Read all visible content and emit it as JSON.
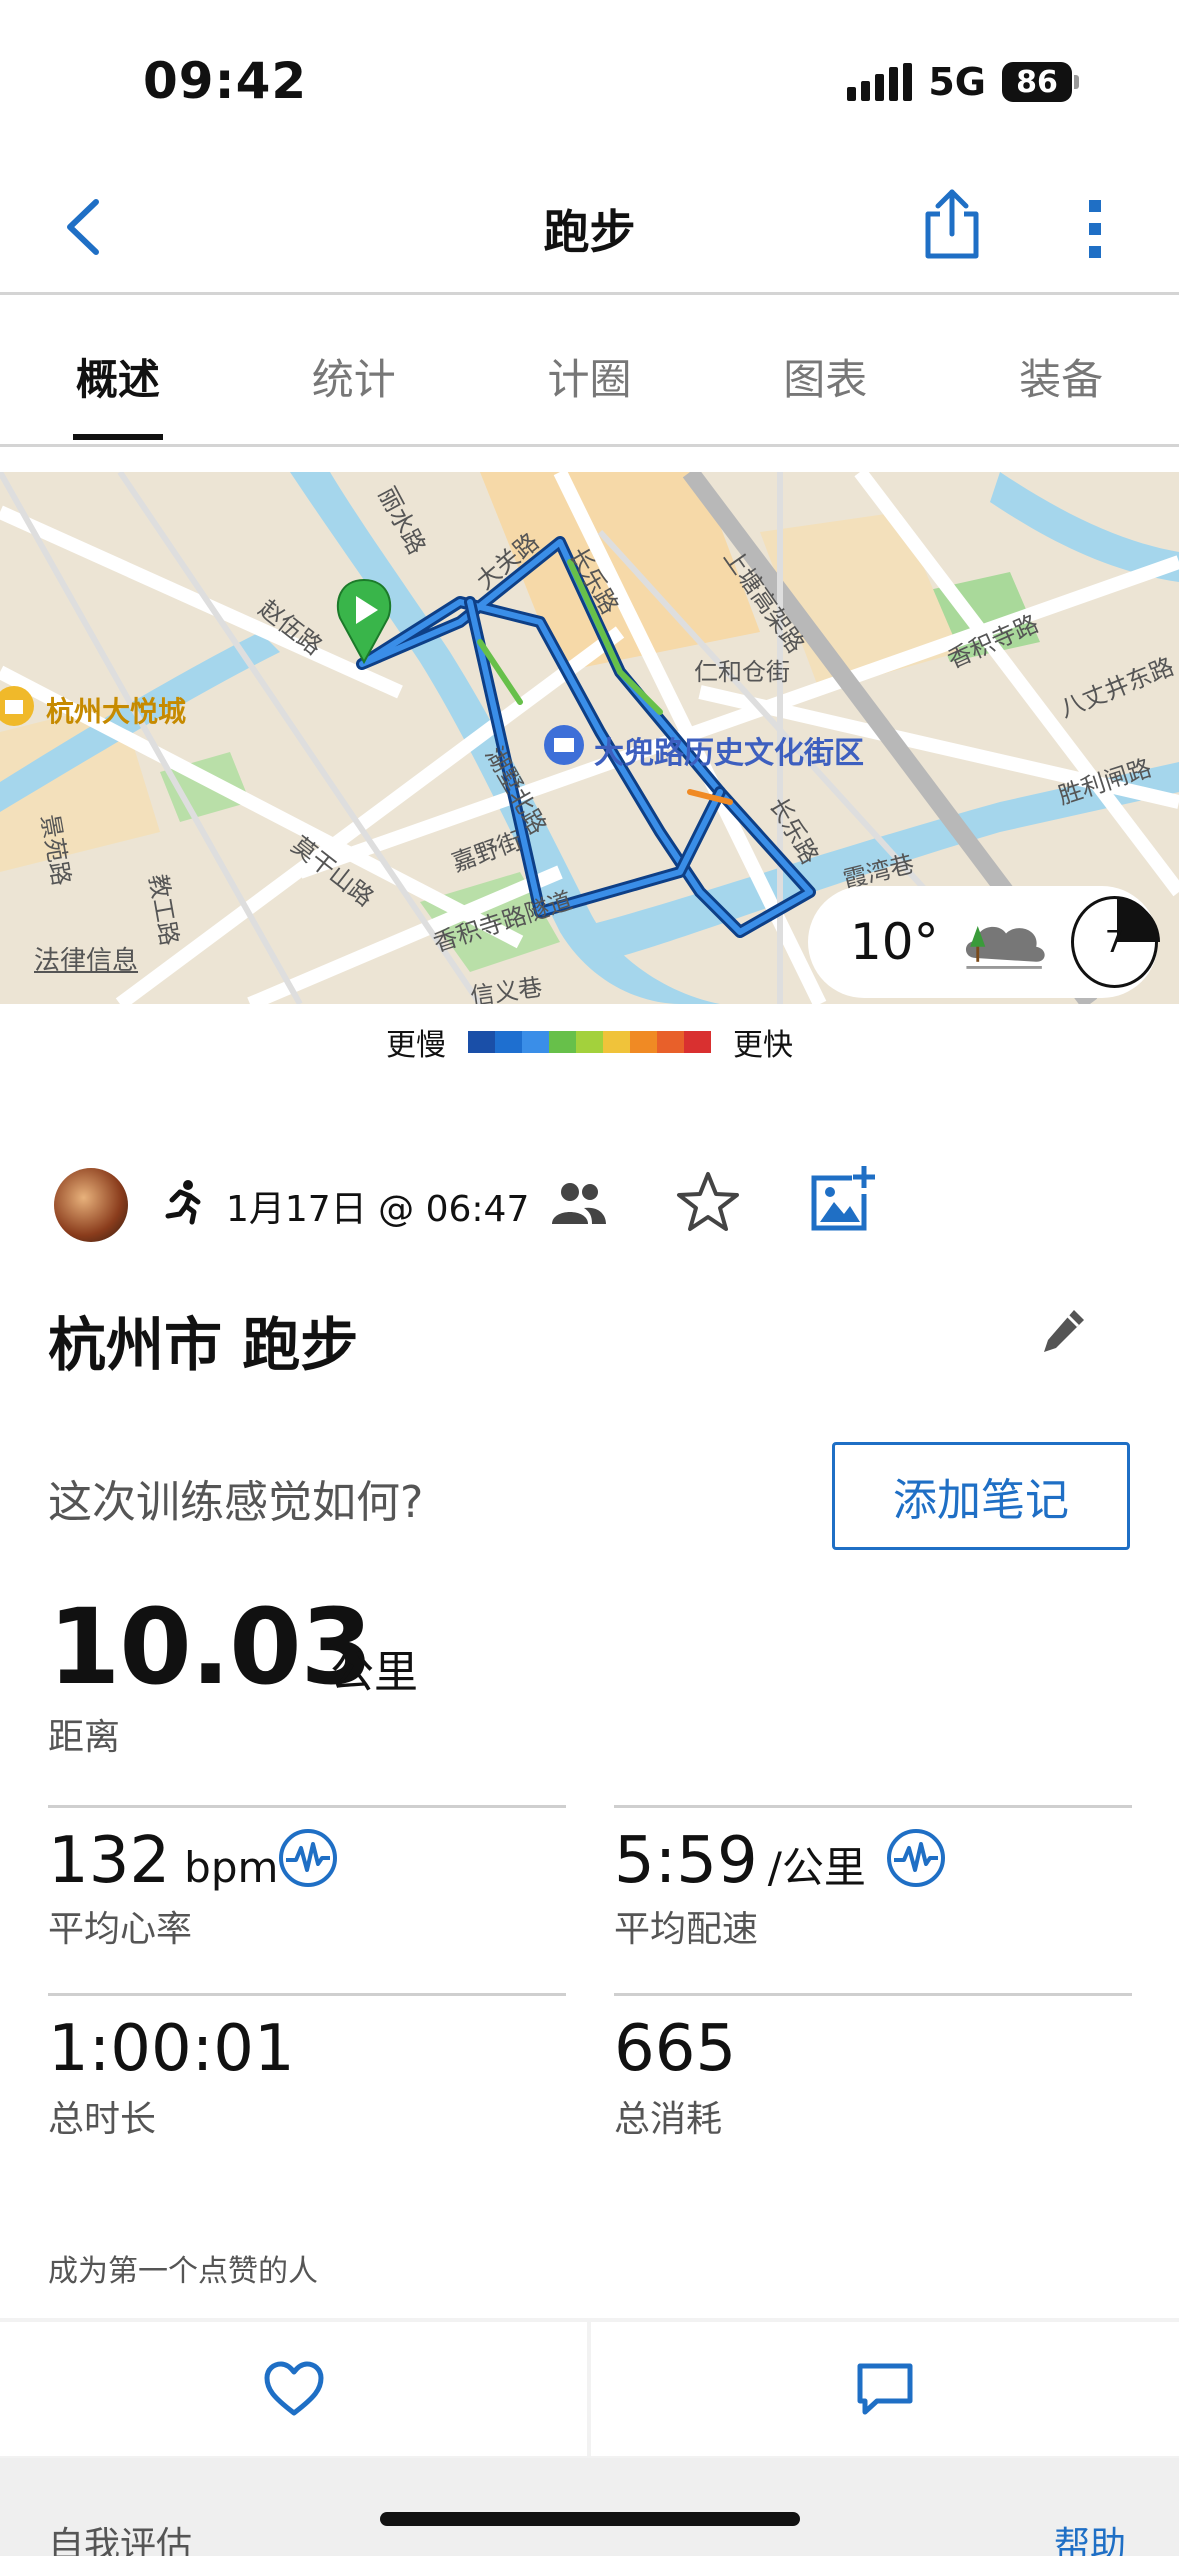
{
  "status": {
    "time": "09:42",
    "network": "5G",
    "battery": "86"
  },
  "nav": {
    "title": "跑步"
  },
  "tabs": [
    "概述",
    "统计",
    "计圈",
    "图表",
    "装备"
  ],
  "map": {
    "labels": [
      "丽水路",
      "大关路",
      "长乐路",
      "赵伍路",
      "湖墅北路",
      "上塘高架路",
      "仁和仓街",
      "香积寺路",
      "八丈井东路",
      "胜利闸路",
      "霞湾巷",
      "嘉野街",
      "莫干山路",
      "教工路",
      "香积寺路隧道",
      "信义巷",
      "景苑路",
      "长乐路"
    ],
    "poi_mall": "杭州大悦城",
    "poi_street": "大兜路历史文化街区",
    "legal": "法律信息",
    "weather_temp": "10°",
    "moon_phase": "7"
  },
  "legend": {
    "slow": "更慢",
    "fast": "更快",
    "colors": [
      "#1a4fa8",
      "#1e6fd0",
      "#3a8ee8",
      "#67c04a",
      "#a3d13c",
      "#f0c33a",
      "#f08a24",
      "#e8602a",
      "#d93030"
    ]
  },
  "activity": {
    "date": "1月17日 @ 06:47",
    "title": "杭州市 跑步",
    "feel_prompt": "这次训练感觉如何?",
    "note_button": "添加笔记"
  },
  "distance": {
    "value": "10.03",
    "unit": "公里",
    "label": "距离"
  },
  "stats": {
    "hr_value": "132",
    "hr_unit": "bpm",
    "hr_label": "平均心率",
    "pace_value": "5:59",
    "pace_unit": "/公里",
    "pace_label": "平均配速",
    "time_value": "1:00:01",
    "time_label": "总时长",
    "cal_value": "665",
    "cal_label": "总消耗"
  },
  "social": {
    "like_prompt": "成为第一个点赞的人"
  },
  "footer": {
    "self_eval": "自我评估",
    "help": "帮助"
  },
  "accent": "#1f6fc5"
}
